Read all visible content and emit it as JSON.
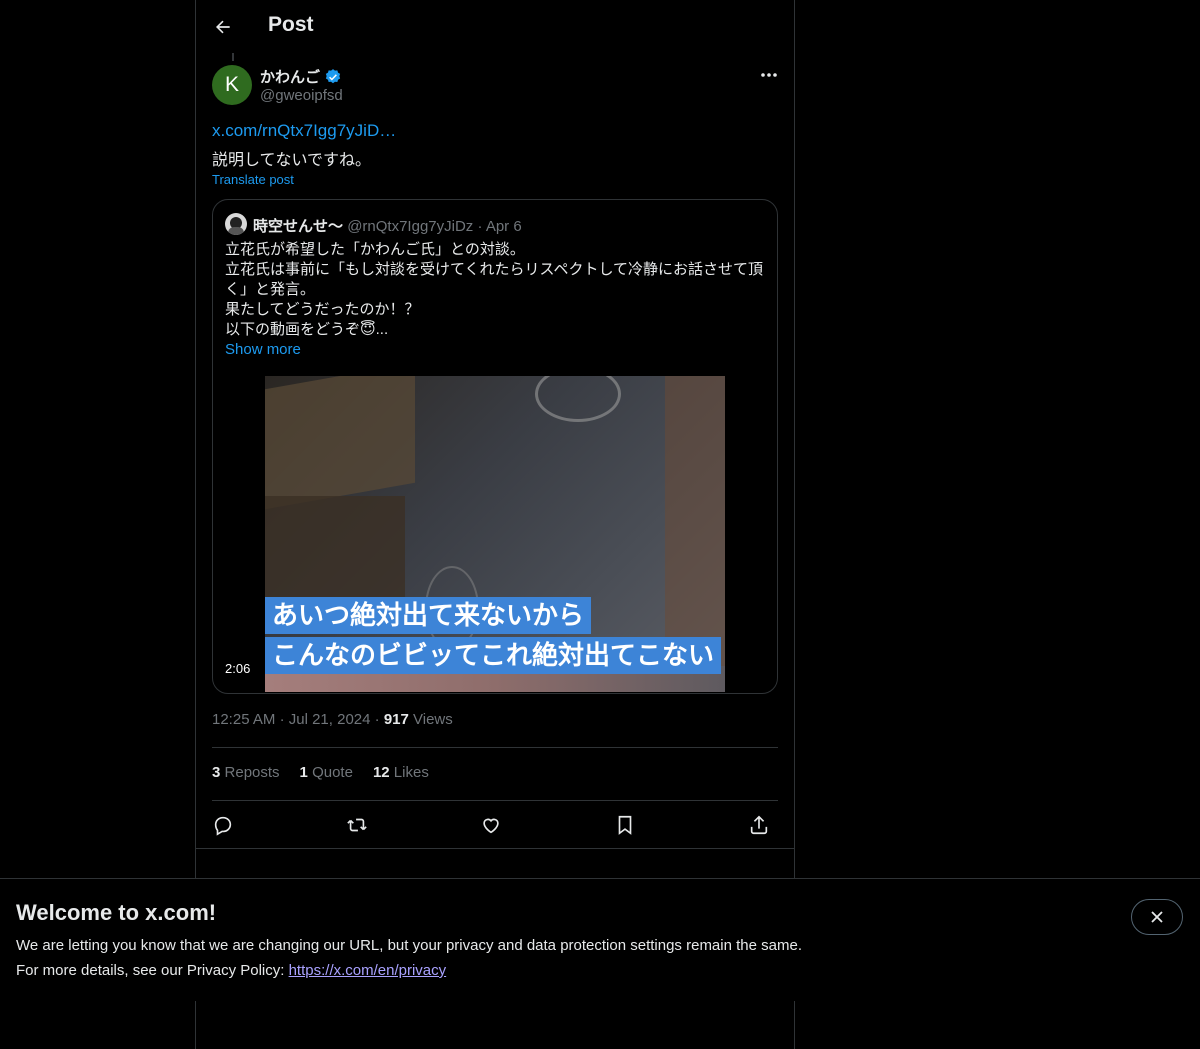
{
  "header": {
    "title": "Post",
    "back_icon": "arrow-left-icon"
  },
  "author": {
    "avatar_letter": "K",
    "avatar_color": "#2f6b1f",
    "name": "かわんご",
    "handle": "@gweoipfsd",
    "verified": true
  },
  "post": {
    "link_text": "x.com/rnQtx7Igg7yJiD…",
    "text": "説明してないですね。",
    "translate_label": "Translate post"
  },
  "quote": {
    "name": "時空せんせ〜",
    "handle": "@rnQtx7Igg7yJiDz",
    "date": "Apr 6",
    "lines": [
      "立花氏が希望した「かわんご氏」との対談。",
      "立花氏は事前に「もし対談を受けてくれたらリスペクトして冷静にお話させて頂",
      "く」と発言。",
      "果たしてどうだったのか！？",
      "以下の動画をどうぞ😇..."
    ],
    "show_more": "Show more",
    "video": {
      "caption_line1": "あいつ絶対出て来ないから",
      "caption_line2": "こんなのビビッてこれ絶対出てこない",
      "duration": "2:06"
    }
  },
  "meta": {
    "time": "12:25 AM",
    "date": "Jul 21, 2024",
    "views_count": "917",
    "views_label": "Views"
  },
  "stats": {
    "reposts_count": "3",
    "reposts_label": "Reposts",
    "quotes_count": "1",
    "quotes_label": "Quote",
    "likes_count": "12",
    "likes_label": "Likes"
  },
  "actions": [
    "reply-icon",
    "repost-icon",
    "like-icon",
    "bookmark-icon",
    "share-icon"
  ],
  "banner": {
    "title": "Welcome to x.com!",
    "line1": "We are letting you know that we are changing our URL, but your privacy and data protection settings remain the same.",
    "line2_prefix": "For more details, see our Privacy Policy: ",
    "link": "https://x.com/en/privacy"
  },
  "colors": {
    "accent": "#1d9bf0",
    "background": "#000000",
    "border": "#2f3336",
    "muted": "#71767b",
    "caption_bg": "#3d84d7"
  }
}
